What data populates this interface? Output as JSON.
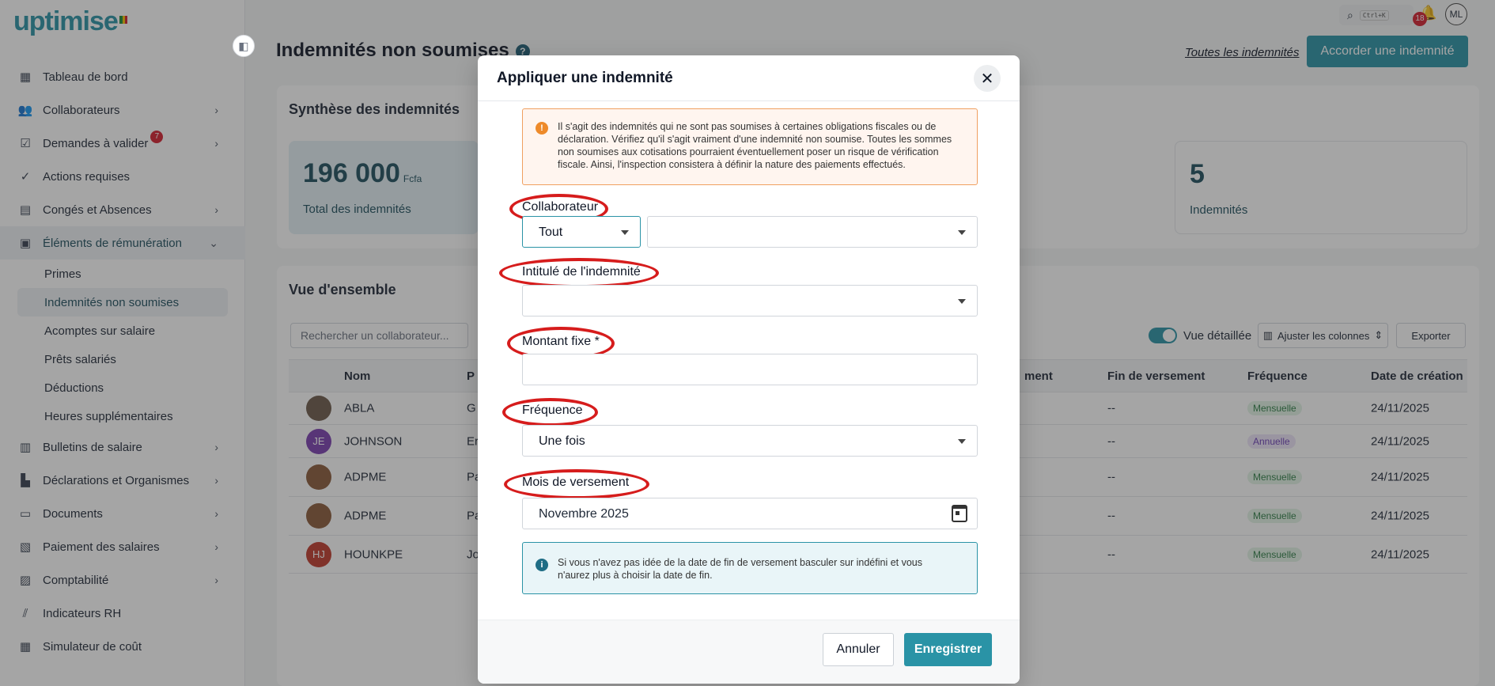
{
  "app": {
    "logo": "uptimise"
  },
  "sidebar": {
    "items": [
      {
        "label": "Tableau de bord",
        "icon": "dashboard-icon"
      },
      {
        "label": "Collaborateurs",
        "icon": "users-icon"
      },
      {
        "label": "Demandes à valider",
        "icon": "checklist-icon",
        "badge": "7"
      },
      {
        "label": "Actions requises",
        "icon": "check-circle-icon"
      },
      {
        "label": "Congés et Absences",
        "icon": "calendar-icon"
      },
      {
        "label": "Éléments de rémunération",
        "icon": "wallet-icon"
      },
      {
        "label": "Bulletins de salaire",
        "icon": "receipt-icon"
      },
      {
        "label": "Déclarations et Organismes",
        "icon": "building-icon"
      },
      {
        "label": "Documents",
        "icon": "folder-icon"
      },
      {
        "label": "Paiement des salaires",
        "icon": "payment-icon"
      },
      {
        "label": "Comptabilité",
        "icon": "calculator-icon"
      },
      {
        "label": "Indicateurs RH",
        "icon": "chart-icon"
      },
      {
        "label": "Simulateur de coût",
        "icon": "simulator-icon"
      }
    ],
    "sub_items": [
      "Primes",
      "Indemnités non soumises",
      "Acomptes sur salaire",
      "Prêts salariés",
      "Déductions",
      "Heures supplémentaires"
    ]
  },
  "topbar": {
    "shortcut": "Ctrl+K",
    "notif_count": "18",
    "user_initials": "ML"
  },
  "header": {
    "title": "Indemnités non soumises",
    "all_link": "Toutes les indemnités",
    "grant_button": "Accorder une indemnité"
  },
  "synthesis": {
    "title": "Synthèse des indemnités",
    "total_value": "196 000",
    "total_unit": "Fcfa",
    "total_label": "Total des indemnités",
    "count_value": "5",
    "count_label": "Indemnités"
  },
  "overview": {
    "title": "Vue d'ensemble",
    "search_placeholder": "Rechercher un collaborateur...",
    "toggle_label": "Vue détaillée",
    "adjust_button": "Ajuster les colonnes",
    "export_button": "Exporter",
    "columns": {
      "name": "Nom",
      "col2": "P",
      "payment": "ment",
      "end": "Fin de versement",
      "frequency": "Fréquence",
      "created": "Date de création"
    },
    "rows": [
      {
        "initials": "",
        "name": "ABLA",
        "col2": "G",
        "end": "--",
        "frequency": "Mensuelle",
        "created": "24/11/2025",
        "avatar_color": "#6d5a4a"
      },
      {
        "initials": "JE",
        "name": "JOHNSON",
        "col2": "Er",
        "end": "--",
        "frequency": "Annuelle",
        "created": "24/11/2025",
        "avatar_color": "#7b3fb0"
      },
      {
        "initials": "",
        "name": "ADPME",
        "col2": "Pa",
        "end": "--",
        "frequency": "Mensuelle",
        "created": "24/11/2025",
        "avatar_color": "#8a5a3a"
      },
      {
        "initials": "",
        "name": "ADPME",
        "col2": "Pa",
        "end": "--",
        "frequency": "Mensuelle",
        "created": "24/11/2025",
        "avatar_color": "#8a5a3a"
      },
      {
        "initials": "HJ",
        "name": "HOUNKPE",
        "col2": "Jo",
        "end": "--",
        "frequency": "Mensuelle",
        "created": "24/11/2025",
        "avatar_color": "#c0392b"
      }
    ]
  },
  "modal": {
    "title": "Appliquer une indemnité",
    "warning": "Il s'agit des indemnités qui ne sont pas soumises à certaines obligations fiscales ou de déclaration. Vérifiez qu'il s'agit vraiment d'une indemnité non soumise. Toutes les sommes non soumises aux cotisations pourraient éventuellement poser un risque de vérification fiscale. Ainsi, l'inspection consistera à définir la nature des paiements effectués.",
    "collaborator_label": "Collaborateur",
    "collaborator_scope": "Tout",
    "collaborator_value": "",
    "allowance_label": "Intitulé de l'indemnité",
    "allowance_value": "",
    "amount_label": "Montant fixe *",
    "amount_value": "",
    "frequency_label": "Fréquence",
    "frequency_value": "Une fois",
    "month_label": "Mois de versement",
    "month_value": "Novembre 2025",
    "info": "Si vous n'avez pas idée de la date de fin de versement basculer sur indéfini et vous n'aurez plus à choisir la date de fin.",
    "cancel_button": "Annuler",
    "save_button": "Enregistrer"
  },
  "colors": {
    "accent": "#2a93a6",
    "annotation_ring": "#d61c1c",
    "warning_border": "#f0a060",
    "badge": "#d4202f"
  }
}
